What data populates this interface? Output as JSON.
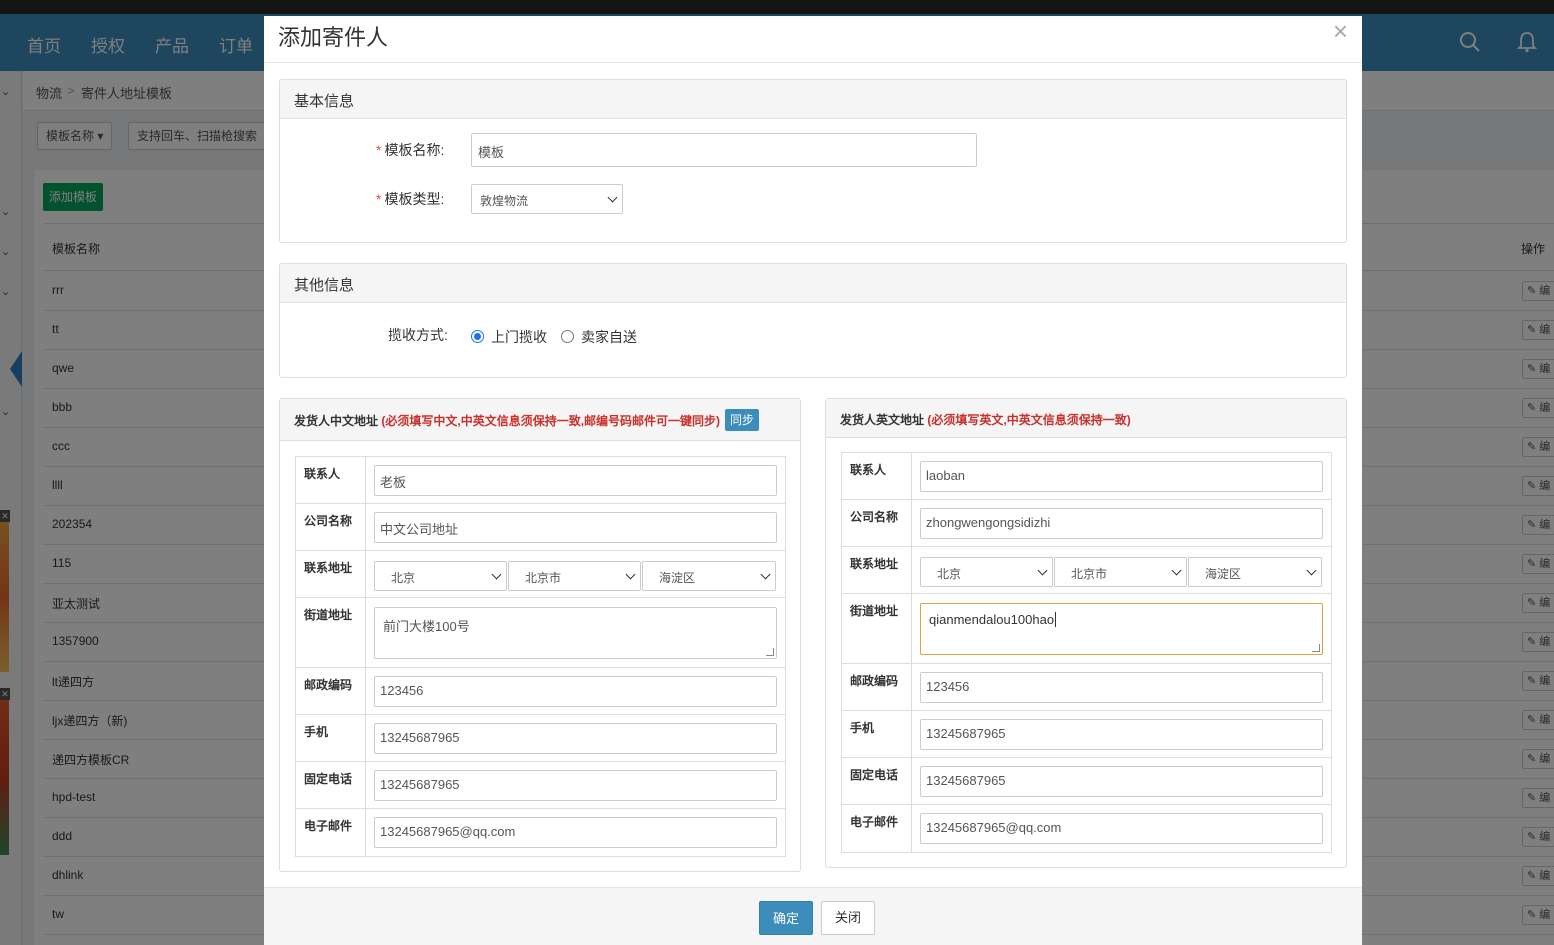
{
  "navbar": {
    "items": [
      "首页",
      "授权",
      "产品",
      "订单"
    ]
  },
  "breadcrumb": {
    "parent": "物流",
    "sep": ">",
    "current": "寄件人地址模板"
  },
  "filters": {
    "field_select": "模板名称 ▾",
    "search_hint": "支持回车、扫描枪搜索"
  },
  "list": {
    "add_button": "添加模板",
    "header_name": "模板名称",
    "header_ops": "操作",
    "edit_label": "编",
    "rows": [
      "rrr",
      "tt",
      "qwe",
      "bbb",
      "ccc",
      "llll",
      "202354",
      "115",
      "亚太测试",
      "1357900",
      "lt递四方",
      "ljx递四方（新)",
      "递四方模板CR",
      "hpd-test",
      "ddd",
      "dhlink",
      "tw"
    ]
  },
  "modal": {
    "title": "添加寄件人",
    "close_symbol": "×",
    "basic": {
      "heading": "基本信息",
      "name_label": "模板名称:",
      "name_placeholder": "模板",
      "type_label": "模板类型:",
      "type_value": "敦煌物流"
    },
    "other": {
      "heading": "其他信息",
      "pickup_label": "揽收方式:",
      "option_pickup": "上门揽收",
      "option_self": "卖家自送",
      "selected": "上门揽收"
    },
    "cn_address": {
      "title": "发货人中文地址",
      "note": "(必须填写中文,中英文信息须保持一致,邮编号码邮件可一键同步)",
      "sync_button": "同步",
      "contact_label": "联系人",
      "contact_value": "老板",
      "company_label": "公司名称",
      "company_value": "中文公司地址",
      "addr_label": "联系地址",
      "province": "北京",
      "city": "北京市",
      "district": "海淀区",
      "street_label": "街道地址",
      "street_value": "前门大楼100号",
      "zip_label": "邮政编码",
      "zip_value": "123456",
      "mobile_label": "手机",
      "mobile_value": "13245687965",
      "phone_label": "固定电话",
      "phone_value": "13245687965",
      "email_label": "电子邮件",
      "email_value": "13245687965@qq.com"
    },
    "en_address": {
      "title": "发货人英文地址",
      "note": "(必须填写英文,中英文信息须保持一致)",
      "contact_label": "联系人",
      "contact_value": "laoban",
      "company_label": "公司名称",
      "company_value": "zhongwengongsidizhi",
      "addr_label": "联系地址",
      "province": "北京",
      "city": "北京市",
      "district": "海淀区",
      "street_label": "街道地址",
      "street_value": "qianmendalou100hao",
      "zip_label": "邮政编码",
      "zip_value": "123456",
      "mobile_label": "手机",
      "mobile_value": "13245687965",
      "phone_label": "固定电话",
      "phone_value": "13245687965",
      "email_label": "电子邮件",
      "email_value": "13245687965@qq.com"
    },
    "footer": {
      "ok": "确定",
      "close": "关闭"
    }
  },
  "colors": {
    "primary": "#3c8dbc",
    "success": "#00a65a",
    "danger": "#c9302c"
  }
}
